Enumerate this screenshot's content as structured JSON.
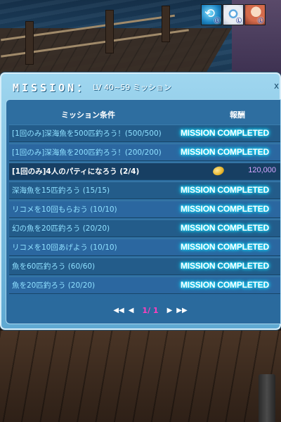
{
  "status_icons": [
    {
      "icon": "wave-buff-icon",
      "level": "Ⓛ"
    },
    {
      "icon": "eye-buff-icon",
      "level": "Ⓛ"
    },
    {
      "icon": "character-buff-icon",
      "level": "Ⓛ"
    }
  ],
  "mission": {
    "title": "MISSION：",
    "subtitle": "LV 40~59 ミッション",
    "close": "x",
    "headers": {
      "condition": "ミッション条件",
      "reward": "報酬"
    },
    "rows": [
      {
        "name": "[1回のみ]深海魚を500匹釣ろう！(500/500)",
        "status": "MISSION COMPLETED",
        "active": false
      },
      {
        "name": "[1回のみ]深海魚を200匹釣ろう！(200/200)",
        "status": "MISSION COMPLETED",
        "active": false
      },
      {
        "name": "[1回のみ]4人のパティになろう (2/4)",
        "status": "",
        "reward": "120,000",
        "active": true
      },
      {
        "name": "深海魚を15匹釣ろう (15/15)",
        "status": "MISSION COMPLETED",
        "active": false
      },
      {
        "name": "リコメを10回もらおう (10/10)",
        "status": "MISSION COMPLETED",
        "active": false
      },
      {
        "name": "幻の魚を20匹釣ろう (20/20)",
        "status": "MISSION COMPLETED",
        "active": false
      },
      {
        "name": "リコメを10回あげよう (10/10)",
        "status": "MISSION COMPLETED",
        "active": false
      },
      {
        "name": "魚を60匹釣ろう (60/60)",
        "status": "MISSION COMPLETED",
        "active": false
      },
      {
        "name": "魚を20匹釣ろう (20/20)",
        "status": "MISSION COMPLETED",
        "active": false
      }
    ],
    "pager": {
      "first": "◀◀",
      "prev": "◀",
      "page": "1/ 1",
      "next": "▶",
      "last": "▶▶"
    }
  }
}
